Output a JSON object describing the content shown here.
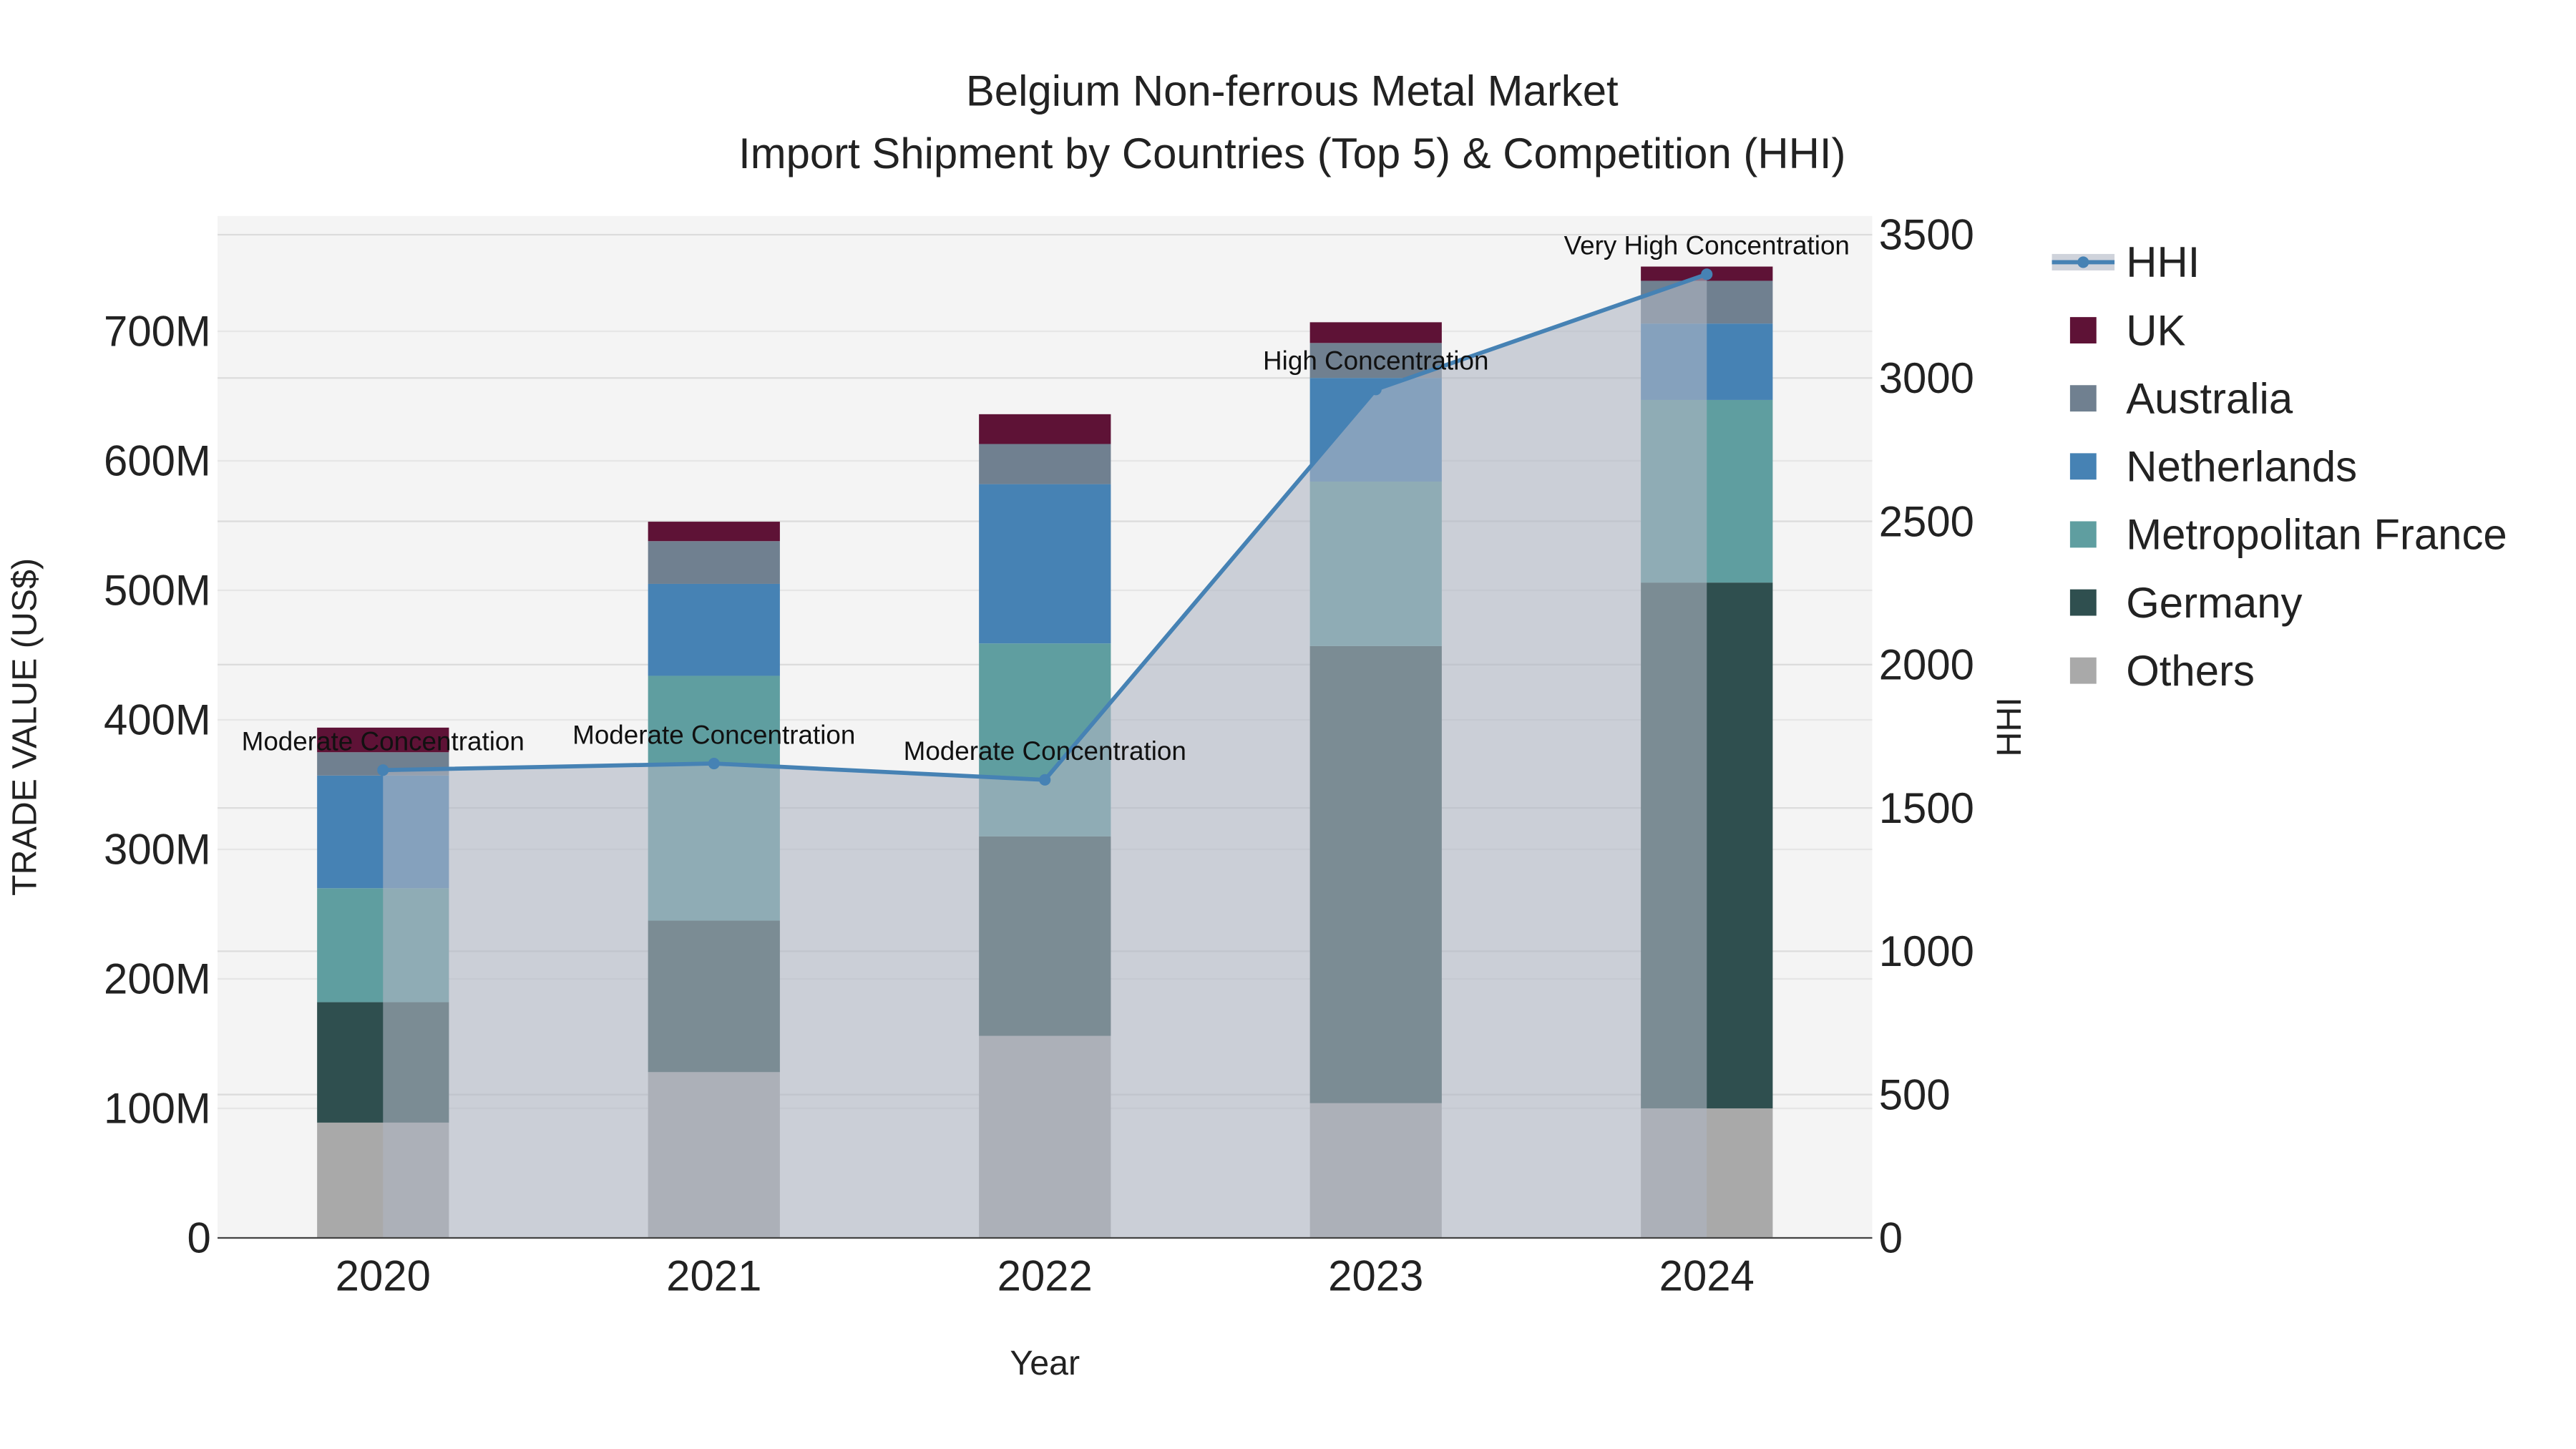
{
  "chart_data": {
    "type": "bar",
    "title_line1": "Belgium Non-ferrous Metal Market",
    "title_line2": "Import Shipment by Countries (Top 5) & Competition (HHI)",
    "xlabel": "Year",
    "ylabel": "TRADE VALUE (US$)",
    "y2label": "HHI",
    "categories": [
      "2020",
      "2021",
      "2022",
      "2023",
      "2024"
    ],
    "ylim": [
      0,
      789
    ],
    "y_unit": "M",
    "yticks": [
      0,
      100,
      200,
      300,
      400,
      500,
      600,
      700
    ],
    "ytick_labels": [
      "0",
      "100M",
      "200M",
      "300M",
      "400M",
      "500M",
      "600M",
      "700M"
    ],
    "y2lim": [
      0,
      3565
    ],
    "y2ticks": [
      "0",
      "500",
      "1000",
      "1500",
      "2000",
      "2500",
      "3000",
      "3500"
    ],
    "series": [
      {
        "name": "Others",
        "color": "#a9a9a9",
        "values": [
          89,
          128,
          156,
          104,
          100
        ]
      },
      {
        "name": "Germany",
        "color": "#2f4f4f",
        "values": [
          93,
          117,
          154,
          353,
          406
        ]
      },
      {
        "name": "Metropolitan France",
        "color": "#5f9ea0",
        "values": [
          88,
          189,
          149,
          127,
          141
        ]
      },
      {
        "name": "Netherlands",
        "color": "#4682b4",
        "values": [
          87,
          71,
          123,
          80,
          59
        ]
      },
      {
        "name": "Australia",
        "color": "#708090",
        "values": [
          18,
          33,
          31,
          27,
          33
        ]
      },
      {
        "name": "UK",
        "color": "#5e1236",
        "values": [
          19,
          15,
          23,
          16,
          11
        ]
      }
    ],
    "hhi": {
      "name": "HHI",
      "color": "#4682b4",
      "values": [
        1632,
        1655,
        1598,
        2960,
        3362
      ],
      "annotations": [
        "Moderate Concentration",
        "Moderate Concentration",
        "Moderate Concentration",
        "High Concentration",
        "Very High Concentration"
      ]
    },
    "legend_order": [
      "HHI",
      "UK",
      "Australia",
      "Netherlands",
      "Metropolitan France",
      "Germany",
      "Others"
    ],
    "legend_placement": "right",
    "grid": true
  }
}
